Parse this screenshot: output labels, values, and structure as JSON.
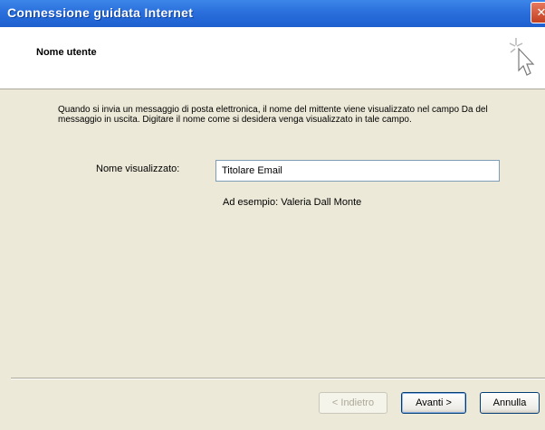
{
  "window": {
    "title": "Connessione guidata Internet",
    "close_glyph": "✕"
  },
  "header": {
    "title": "Nome utente",
    "icon": "wizard-cursor-icon"
  },
  "content": {
    "description": "Quando si invia un messaggio di posta elettronica, il nome del mittente viene visualizzato nel campo Da del messaggio in uscita. Digitare il nome come si desidera venga visualizzato in tale campo.",
    "field_label": "Nome visualizzato:",
    "field_value": "Titolare Email",
    "example": "Ad esempio: Valeria Dall Monte"
  },
  "buttons": {
    "back": "< Indietro",
    "next": "Avanti >",
    "cancel": "Annulla"
  },
  "colors": {
    "titlebar": "#2a6fdc",
    "dialog_bg": "#ece9d8",
    "header_bg": "#ffffff"
  }
}
